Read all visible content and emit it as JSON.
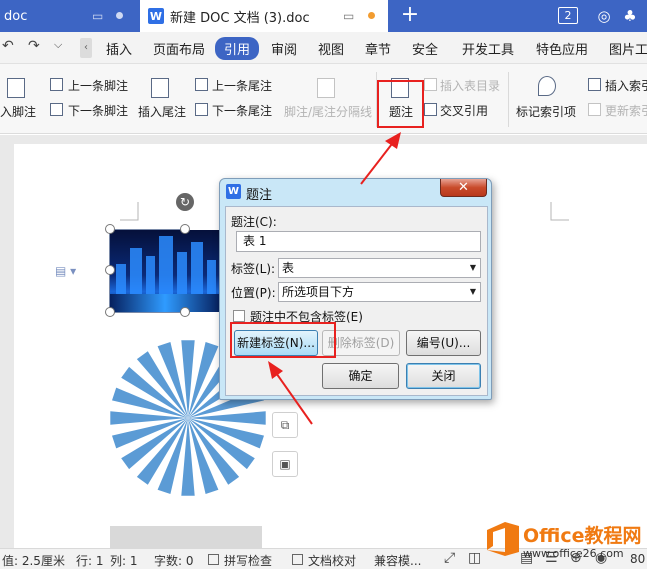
{
  "titlebar": {
    "tab_inactive_label": "doc",
    "tab_active_label": "新建 DOC 文档 (3).doc",
    "doc_icon_glyph": "W",
    "window_count": "2"
  },
  "menu": {
    "items": [
      "插入",
      "页面布局",
      "引用",
      "审阅",
      "视图",
      "章节",
      "安全",
      "开发工具",
      "特色应用",
      "图片工"
    ],
    "active": "引用"
  },
  "ribbon": {
    "insert_footnote": "入脚注",
    "prev_footnote": "上一条脚注",
    "next_footnote": "下一条脚注",
    "insert_endnote": "插入尾注",
    "prev_endnote": "上一条尾注",
    "next_endnote": "下一条尾注",
    "separator_label": "脚注/尾注分隔线",
    "caption": "题注",
    "insert_table_of_figures": "插入表目录",
    "cross_reference": "交叉引用",
    "mark_index": "标记索引项",
    "insert_index": "插入索引",
    "update_index": "更新索引"
  },
  "dialog": {
    "title": "题注",
    "caption_label": "题注(C):",
    "caption_value": "表 1",
    "label_label": "标签(L):",
    "label_value": "表",
    "position_label": "位置(P):",
    "position_value": "所选项目下方",
    "exclude_label": "题注中不包含标签(E)",
    "new_label_button": "新建标签(N)...",
    "delete_label_button": "删除标签(D)",
    "numbering_button": "编号(U)...",
    "ok_button": "确定",
    "close_button": "关闭"
  },
  "status": {
    "position": "值: 2.5厘米",
    "line": "行: 1",
    "column": "列: 1",
    "word_count": "字数: 0",
    "spell_check": "拼写检查",
    "doc_proof": "文档校对",
    "compat_mode": "兼容模...",
    "zoom": "80"
  },
  "watermark": {
    "site_name": "Office教程网",
    "url": "www.office26.com"
  },
  "colors": {
    "accent": "#3d65c4",
    "highlight": "#e8211f",
    "star": "#5b9bd5"
  }
}
